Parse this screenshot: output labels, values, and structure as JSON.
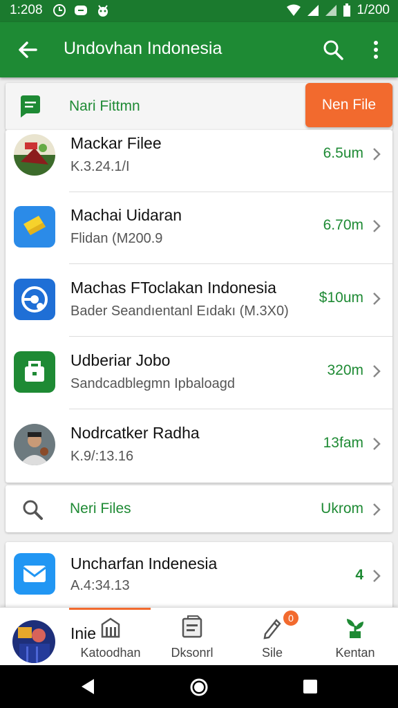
{
  "status": {
    "time": "1:208",
    "clock": "1/200"
  },
  "appbar": {
    "title": "Undovhan Indonesia"
  },
  "header": {
    "label": "Nari Fittmn",
    "new_button": "Nen File"
  },
  "files": [
    {
      "name": "Mackar Filee",
      "sub": "K.3.24.1/I",
      "size": "6.5um",
      "icon": "photo-thumbnail-icon"
    },
    {
      "name": "Machai Uidaran",
      "sub": "Flidan  (M200.9",
      "size": "6.70m",
      "icon": "folder-tag-icon"
    },
    {
      "name": "Machas FToclakan Indonesia",
      "sub": "Bader  Seandıentanl Eıdakı (M.3X0)",
      "size": "$10um",
      "icon": "settings-disc-icon"
    },
    {
      "name": "Udberiar Jobo",
      "sub": "Sandcadblegmn Ipbaloagd",
      "size": "320m",
      "icon": "briefcase-icon"
    },
    {
      "name": "Nodrcatker Radha",
      "sub": "K.9/:13.16",
      "size": "13fam",
      "icon": "person-photo-icon"
    }
  ],
  "search": {
    "label": "Neri Files",
    "value": "Ukrom"
  },
  "bottom_item": {
    "name": "Uncharfan Indenesia",
    "sub": "A.4:34.13",
    "count": "4"
  },
  "navbar": {
    "overlay_text": "Inie",
    "items": [
      {
        "label": "Katoodhan",
        "icon": "building-icon"
      },
      {
        "label": "Dksonrl",
        "icon": "document-icon"
      },
      {
        "label": "Sile",
        "icon": "pencil-icon",
        "badge": "0"
      },
      {
        "label": "Kentan",
        "icon": "plant-icon"
      }
    ]
  },
  "colors": {
    "primary": "#1e8a34",
    "accent": "#f26a2e"
  }
}
